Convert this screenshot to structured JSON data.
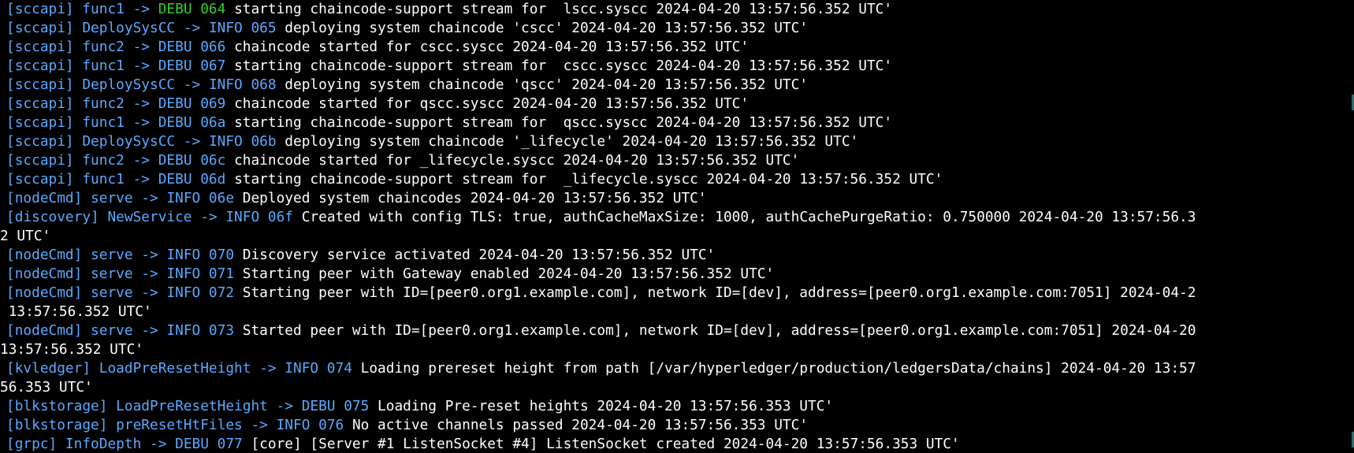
{
  "colors": {
    "background": "#000000",
    "module": "#5aa9ff",
    "level_info": "#5aa9ff",
    "level_debug_highlight": "#33cc33",
    "message": "#ffffff"
  },
  "lines": [
    {
      "mod": "[sccapi] func1 -> ",
      "lvl": "DEBU 064",
      "hl": true,
      "msg": " starting chaincode-support stream for  lscc.syscc 2024-04-20 13:57:56.352 UTC'"
    },
    {
      "mod": "[sccapi] DeploySysCC -> ",
      "lvl": "INFO 065",
      "msg": " deploying system chaincode 'cscc' 2024-04-20 13:57:56.352 UTC'"
    },
    {
      "mod": "[sccapi] func2 -> ",
      "lvl": "DEBU 066",
      "msg": " chaincode started for cscc.syscc 2024-04-20 13:57:56.352 UTC'"
    },
    {
      "mod": "[sccapi] func1 -> ",
      "lvl": "DEBU 067",
      "msg": " starting chaincode-support stream for  cscc.syscc 2024-04-20 13:57:56.352 UTC'"
    },
    {
      "mod": "[sccapi] DeploySysCC -> ",
      "lvl": "INFO 068",
      "msg": " deploying system chaincode 'qscc' 2024-04-20 13:57:56.352 UTC'"
    },
    {
      "mod": "[sccapi] func2 -> ",
      "lvl": "DEBU 069",
      "msg": " chaincode started for qscc.syscc 2024-04-20 13:57:56.352 UTC'"
    },
    {
      "mod": "[sccapi] func1 -> ",
      "lvl": "DEBU 06a",
      "msg": " starting chaincode-support stream for  qscc.syscc 2024-04-20 13:57:56.352 UTC'"
    },
    {
      "mod": "[sccapi] DeploySysCC -> ",
      "lvl": "INFO 06b",
      "msg": " deploying system chaincode '_lifecycle' 2024-04-20 13:57:56.352 UTC'"
    },
    {
      "mod": "[sccapi] func2 -> ",
      "lvl": "DEBU 06c",
      "msg": " chaincode started for _lifecycle.syscc 2024-04-20 13:57:56.352 UTC'"
    },
    {
      "mod": "[sccapi] func1 -> ",
      "lvl": "DEBU 06d",
      "msg": " starting chaincode-support stream for  _lifecycle.syscc 2024-04-20 13:57:56.352 UTC'"
    },
    {
      "mod": "[nodeCmd] serve -> ",
      "lvl": "INFO 06e",
      "msg": " Deployed system chaincodes 2024-04-20 13:57:56.352 UTC'"
    },
    {
      "mod": "[discovery] NewService -> ",
      "lvl": "INFO 06f",
      "msg": " Created with config TLS: true, authCacheMaxSize: 1000, authCachePurgeRatio: 0.750000 2024-04-20 13:57:56.3"
    },
    {
      "cont": true,
      "msg": "2 UTC'"
    },
    {
      "mod": "[nodeCmd] serve -> ",
      "lvl": "INFO 070",
      "msg": " Discovery service activated 2024-04-20 13:57:56.352 UTC'"
    },
    {
      "mod": "[nodeCmd] serve -> ",
      "lvl": "INFO 071",
      "msg": " Starting peer with Gateway enabled 2024-04-20 13:57:56.352 UTC'"
    },
    {
      "mod": "[nodeCmd] serve -> ",
      "lvl": "INFO 072",
      "msg": " Starting peer with ID=[peer0.org1.example.com], network ID=[dev], address=[peer0.org1.example.com:7051] 2024-04-2"
    },
    {
      "cont": true,
      "msg": " 13:57:56.352 UTC'"
    },
    {
      "mod": "[nodeCmd] serve -> ",
      "lvl": "INFO 073",
      "msg": " Started peer with ID=[peer0.org1.example.com], network ID=[dev], address=[peer0.org1.example.com:7051] 2024-04-20"
    },
    {
      "cont": true,
      "msg": "13:57:56.352 UTC'"
    },
    {
      "mod": "[kvledger] LoadPreResetHeight -> ",
      "lvl": "INFO 074",
      "msg": " Loading prereset height from path [/var/hyperledger/production/ledgersData/chains] 2024-04-20 13:57"
    },
    {
      "cont": true,
      "msg": "56.353 UTC'"
    },
    {
      "mod": "[blkstorage] LoadPreResetHeight -> ",
      "lvl": "DEBU 075",
      "msg": " Loading Pre-reset heights 2024-04-20 13:57:56.353 UTC'"
    },
    {
      "mod": "[blkstorage] preResetHtFiles -> ",
      "lvl": "INFO 076",
      "msg": " No active channels passed 2024-04-20 13:57:56.353 UTC'"
    },
    {
      "mod": "[grpc] InfoDepth -> ",
      "lvl": "DEBU 077",
      "msg": " [core] [Server #1 ListenSocket #4] ListenSocket created 2024-04-20 13:57:56.353 UTC'"
    }
  ]
}
